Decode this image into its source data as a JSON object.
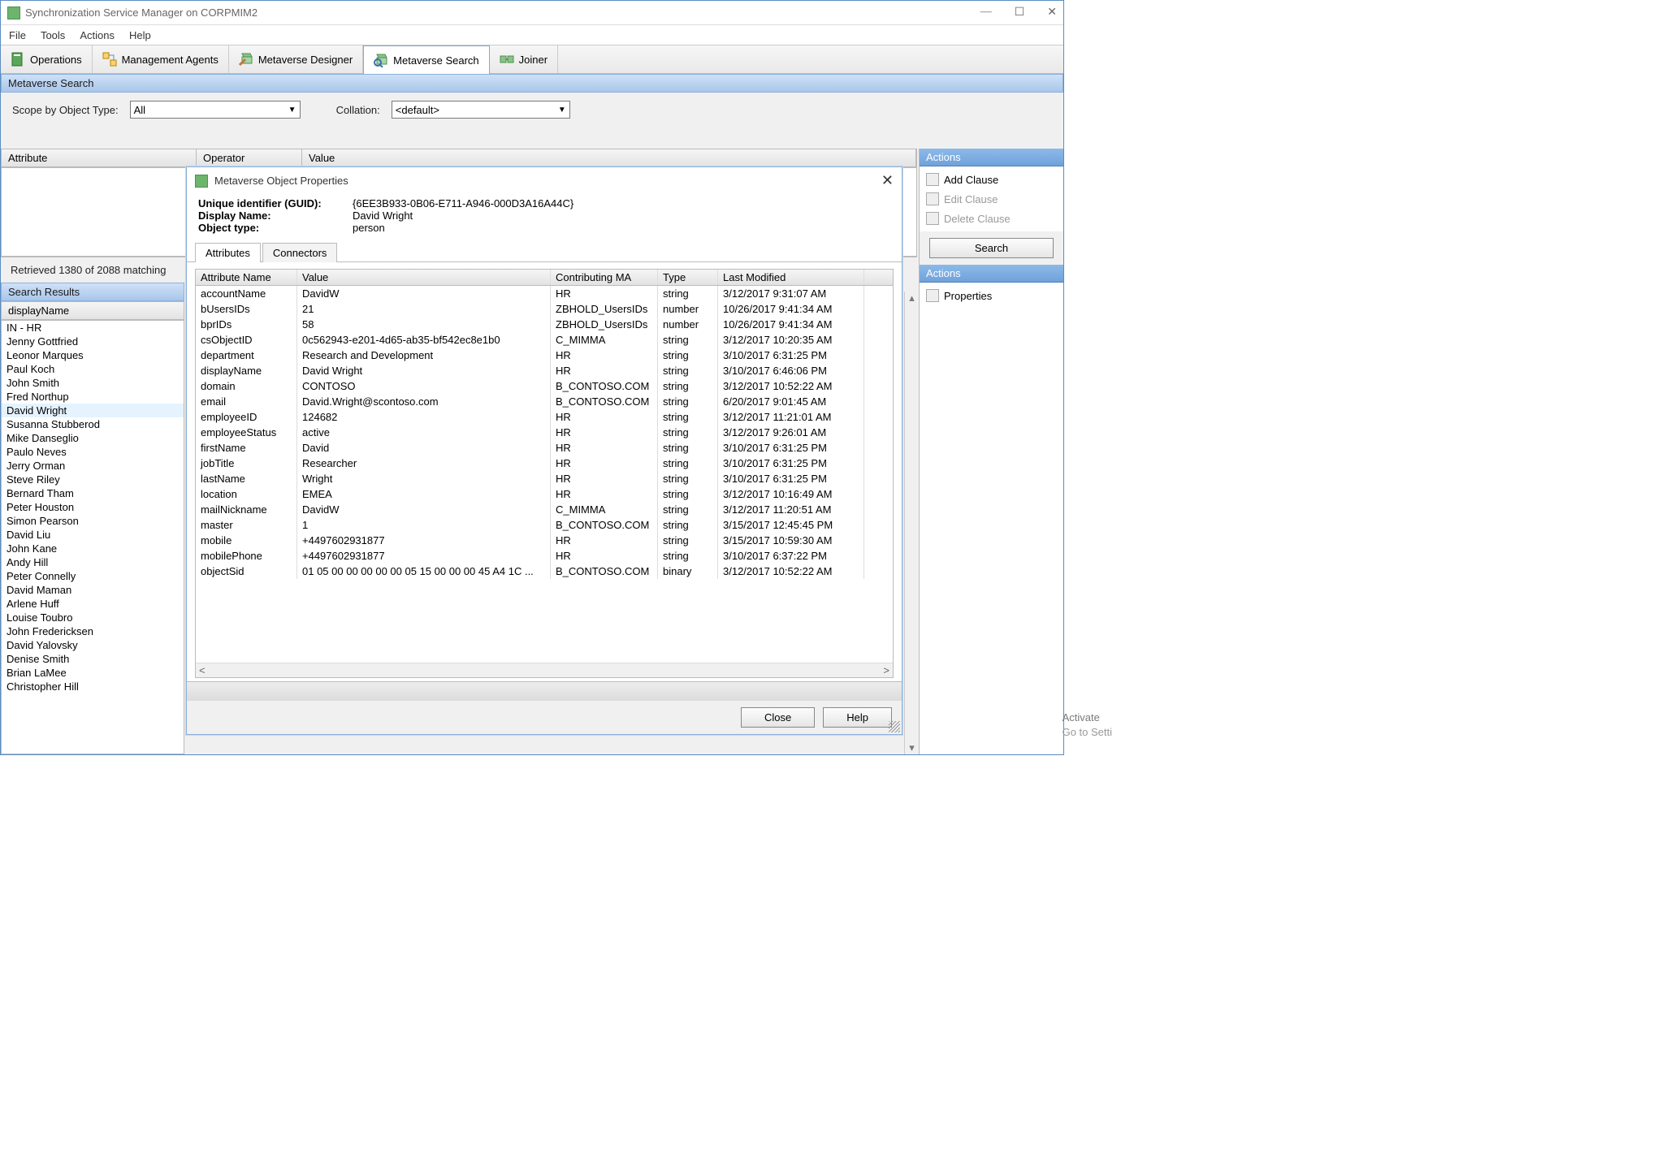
{
  "window": {
    "title": "Synchronization Service Manager on CORPMIM2"
  },
  "menu": {
    "file": "File",
    "tools": "Tools",
    "actions": "Actions",
    "help": "Help"
  },
  "toolbar": {
    "operations": "Operations",
    "ma": "Management Agents",
    "mvd": "Metaverse Designer",
    "mvs": "Metaverse Search",
    "joiner": "Joiner"
  },
  "search": {
    "section": "Metaverse Search",
    "scope_label": "Scope by Object Type:",
    "scope_value": "All",
    "collation_label": "Collation:",
    "collation_value": "<default>",
    "cols": {
      "attribute": "Attribute",
      "operator": "Operator",
      "value": "Value"
    },
    "status": "Retrieved 1380 of 2088 matching",
    "button": "Search"
  },
  "results": {
    "section": "Search Results",
    "col": "displayName",
    "items": [
      "IN - HR",
      "Jenny Gottfried",
      "Leonor Marques",
      "Paul Koch",
      "John Smith",
      "Fred Northup",
      "David Wright",
      "Susanna Stubberod",
      "Mike Danseglio",
      "Paulo Neves",
      "Jerry Orman",
      "Steve Riley",
      "Bernard Tham",
      "Peter Houston",
      "Simon Pearson",
      "David Liu",
      "John Kane",
      "Andy Hill",
      "Peter Connelly",
      "David Maman",
      "Arlene Huff",
      "Louise Toubro",
      "John Fredericksen",
      "David Yalovsky",
      "Denise Smith",
      "Brian LaMee",
      "Christopher Hill"
    ],
    "selected_index": 6
  },
  "actions_top": {
    "head": "Actions",
    "add": "Add Clause",
    "edit": "Edit Clause",
    "delete": "Delete Clause"
  },
  "actions_bottom": {
    "head": "Actions",
    "props": "Properties"
  },
  "dialog": {
    "title": "Metaverse Object Properties",
    "guid_label": "Unique identifier (GUID):",
    "guid": "{6EE3B933-0B06-E711-A946-000D3A16A44C}",
    "dn_label": "Display Name:",
    "dn": "David Wright",
    "ot_label": "Object type:",
    "ot": "person",
    "tabs": {
      "attributes": "Attributes",
      "connectors": "Connectors"
    },
    "grid_cols": {
      "c1": "Attribute Name",
      "c2": "Value",
      "c3": "Contributing MA",
      "c4": "Type",
      "c5": "Last Modified"
    },
    "rows": [
      {
        "c1": "accountName",
        "c2": "DavidW",
        "c3": "HR",
        "c4": "string",
        "c5": "3/12/2017 9:31:07 AM"
      },
      {
        "c1": "bUsersIDs",
        "c2": "21",
        "c3": "ZBHOLD_UsersIDs",
        "c4": "number",
        "c5": "10/26/2017 9:41:34 AM"
      },
      {
        "c1": "bprIDs",
        "c2": "58",
        "c3": "ZBHOLD_UsersIDs",
        "c4": "number",
        "c5": "10/26/2017 9:41:34 AM"
      },
      {
        "c1": "csObjectID",
        "c2": "0c562943-e201-4d65-ab35-bf542ec8e1b0",
        "c3": "C_MIMMA",
        "c4": "string",
        "c5": "3/12/2017 10:20:35 AM"
      },
      {
        "c1": "department",
        "c2": "Research and Development",
        "c3": "HR",
        "c4": "string",
        "c5": "3/10/2017 6:31:25 PM"
      },
      {
        "c1": "displayName",
        "c2": "David Wright",
        "c3": "HR",
        "c4": "string",
        "c5": "3/10/2017 6:46:06 PM"
      },
      {
        "c1": "domain",
        "c2": "CONTOSO",
        "c3": "B_CONTOSO.COM",
        "c4": "string",
        "c5": "3/12/2017 10:52:22 AM"
      },
      {
        "c1": "email",
        "c2": "David.Wright@scontoso.com",
        "c3": "B_CONTOSO.COM",
        "c4": "string",
        "c5": "6/20/2017 9:01:45 AM"
      },
      {
        "c1": "employeeID",
        "c2": "124682",
        "c3": "HR",
        "c4": "string",
        "c5": "3/12/2017 11:21:01 AM"
      },
      {
        "c1": "employeeStatus",
        "c2": "active",
        "c3": "HR",
        "c4": "string",
        "c5": "3/12/2017 9:26:01 AM"
      },
      {
        "c1": "firstName",
        "c2": "David",
        "c3": "HR",
        "c4": "string",
        "c5": "3/10/2017 6:31:25 PM"
      },
      {
        "c1": "jobTitle",
        "c2": "Researcher",
        "c3": "HR",
        "c4": "string",
        "c5": "3/10/2017 6:31:25 PM"
      },
      {
        "c1": "lastName",
        "c2": "Wright",
        "c3": "HR",
        "c4": "string",
        "c5": "3/10/2017 6:31:25 PM"
      },
      {
        "c1": "location",
        "c2": "EMEA",
        "c3": "HR",
        "c4": "string",
        "c5": "3/12/2017 10:16:49 AM"
      },
      {
        "c1": "mailNickname",
        "c2": "DavidW",
        "c3": "C_MIMMA",
        "c4": "string",
        "c5": "3/12/2017 11:20:51 AM"
      },
      {
        "c1": "master",
        "c2": "1",
        "c3": "B_CONTOSO.COM",
        "c4": "string",
        "c5": "3/15/2017 12:45:45 PM"
      },
      {
        "c1": "mobile",
        "c2": "+4497602931877",
        "c3": "HR",
        "c4": "string",
        "c5": "3/15/2017 10:59:30 AM"
      },
      {
        "c1": "mobilePhone",
        "c2": "+4497602931877",
        "c3": "HR",
        "c4": "string",
        "c5": "3/10/2017 6:37:22 PM"
      },
      {
        "c1": "objectSid",
        "c2": "01 05 00 00 00 00 00 05 15 00 00 00 45 A4 1C ...",
        "c3": "B_CONTOSO.COM",
        "c4": "binary",
        "c5": "3/12/2017 10:52:22 AM"
      }
    ],
    "close": "Close",
    "help": "Help"
  },
  "watermark": {
    "line1": "Activate",
    "line2": "Go to Setti"
  }
}
